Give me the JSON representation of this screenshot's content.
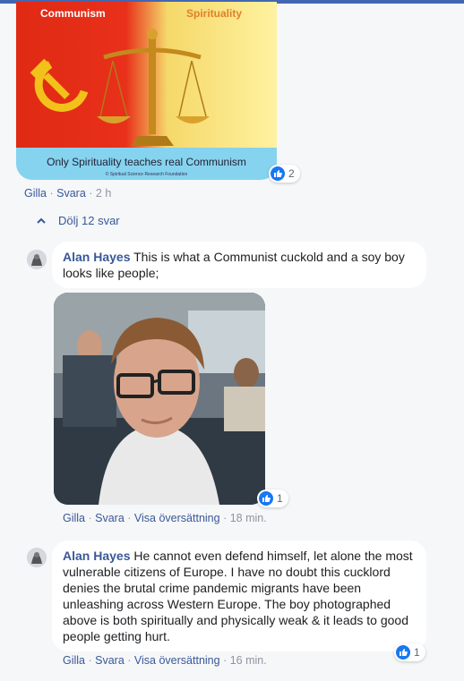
{
  "post_image": {
    "left_caption": "Communism",
    "right_caption": "Spirituality",
    "tagline": "Only Spirituality teaches real Communism",
    "source_line": "© Spiritual Science Research Foundation"
  },
  "top_comment": {
    "reaction_count": "2",
    "actions": {
      "like": "Gilla",
      "reply": "Svara",
      "time": "2 h"
    }
  },
  "replies_toggle": {
    "label": "Dölj 12 svar"
  },
  "replies": [
    {
      "author": "Alan Hayes",
      "text": "This is what a Communist cuckold and a soy boy looks like people;",
      "reaction_count": "1",
      "actions": {
        "like": "Gilla",
        "reply": "Svara",
        "translate": "Visa översättning",
        "time": "18 min."
      }
    },
    {
      "author": "Alan Hayes",
      "text": "He cannot even defend himself, let alone the most vulnerable citizens of Europe. I have no doubt this cucklord denies the brutal crime pandemic migrants have been unleashing across Western Europe. The boy photographed above is both spiritually and physically weak & it leads to good people getting hurt.",
      "reaction_count": "1",
      "actions": {
        "like": "Gilla",
        "reply": "Svara",
        "translate": "Visa översättning",
        "time": "16 min."
      }
    }
  ],
  "colors": {
    "link": "#385898",
    "like_blue": "#1877f2",
    "background": "#f6f7f9"
  },
  "icons": [
    "like-icon",
    "chevron-up-icon",
    "hammer-sickle-icon",
    "scales-icon",
    "avatar"
  ]
}
